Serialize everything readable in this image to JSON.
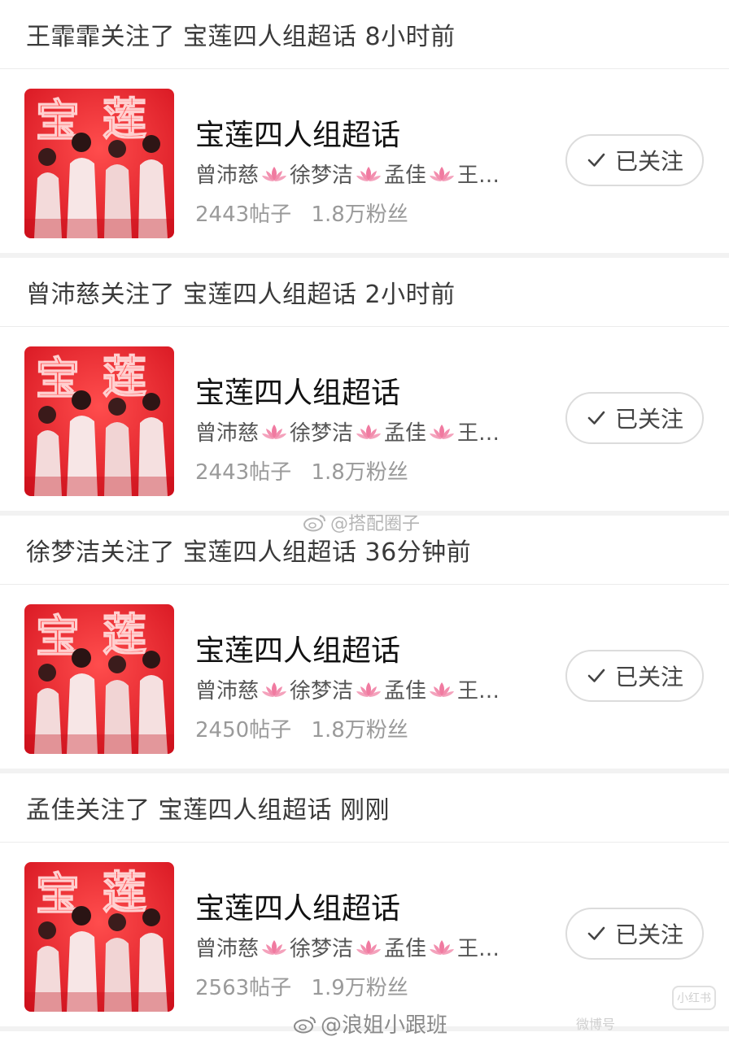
{
  "activities": [
    {
      "header": {
        "user": "王霏霏关注了",
        "topic": "宝莲四人组超话",
        "time": "8小时前"
      },
      "card": {
        "title": "宝莲四人组超话",
        "members": [
          "曾沛慈",
          "徐梦洁",
          "孟佳",
          "王…"
        ],
        "posts": "2443帖子",
        "fans": "1.8万粉丝",
        "button_label": "已关注"
      }
    },
    {
      "header": {
        "user": "曾沛慈关注了",
        "topic": "宝莲四人组超话",
        "time": "2小时前"
      },
      "card": {
        "title": "宝莲四人组超话",
        "members": [
          "曾沛慈",
          "徐梦洁",
          "孟佳",
          "王…"
        ],
        "posts": "2443帖子",
        "fans": "1.8万粉丝",
        "button_label": "已关注"
      }
    },
    {
      "header": {
        "user": "徐梦洁关注了",
        "topic": "宝莲四人组超话",
        "time": "36分钟前"
      },
      "card": {
        "title": "宝莲四人组超话",
        "members": [
          "曾沛慈",
          "徐梦洁",
          "孟佳",
          "王…"
        ],
        "posts": "2450帖子",
        "fans": "1.8万粉丝",
        "button_label": "已关注"
      }
    },
    {
      "header": {
        "user": "孟佳关注了",
        "topic": "宝莲四人组超话",
        "time": "刚刚"
      },
      "card": {
        "title": "宝莲四人组超话",
        "members": [
          "曾沛慈",
          "徐梦洁",
          "孟佳",
          "王…"
        ],
        "posts": "2563帖子",
        "fans": "1.9万粉丝",
        "button_label": "已关注"
      }
    }
  ],
  "thumbnail": {
    "banner_text": [
      "宝",
      "莲"
    ],
    "icon": "group-photo-thumbnail",
    "background_color": "#d4121e",
    "text_color": "#ff3b3b"
  },
  "watermarks": {
    "middle": "@搭配圈子",
    "bottom": "@浪姐小跟班",
    "bottom_right": "微博号",
    "corner_logo": "小红书"
  },
  "colors": {
    "divider": "#ececec",
    "muted_text": "#9a9a9a",
    "lotus": "#f07aa0"
  }
}
